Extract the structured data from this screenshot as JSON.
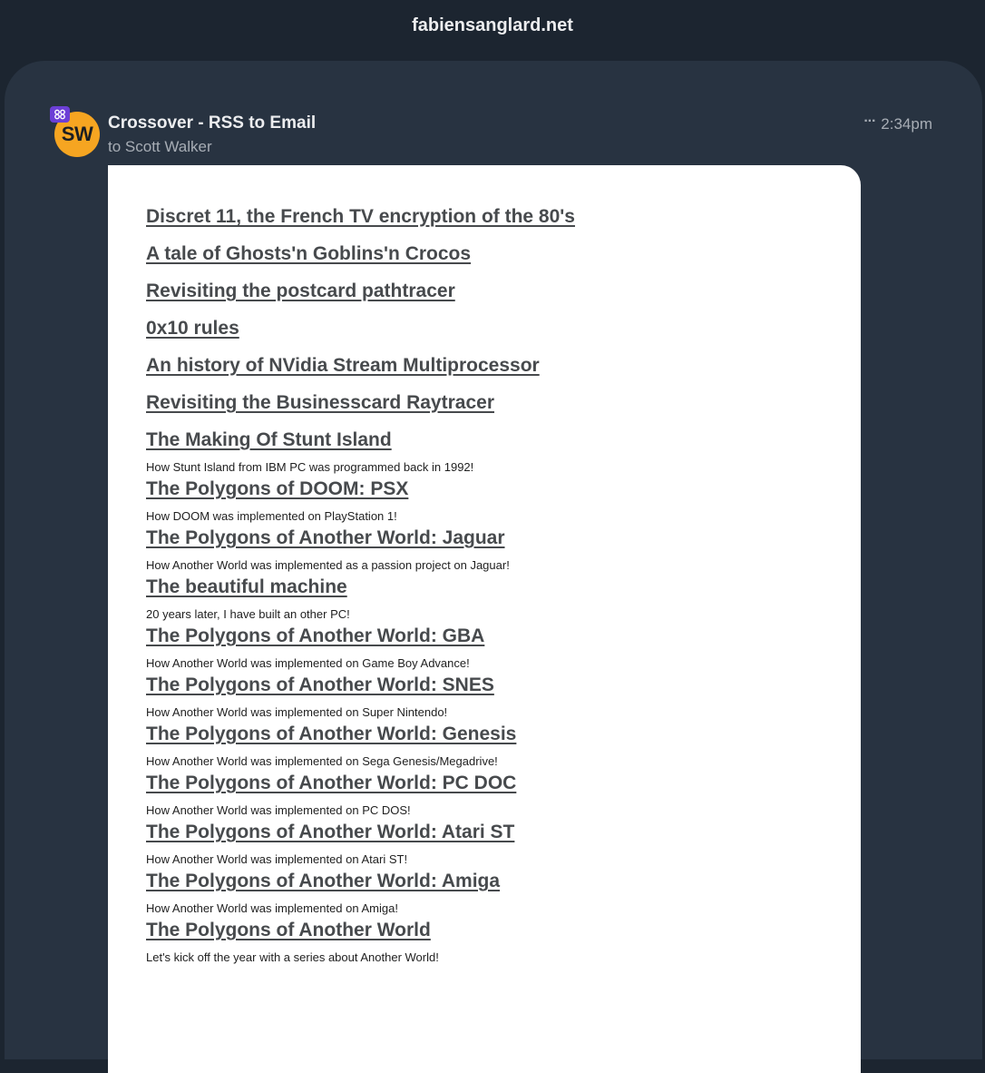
{
  "window": {
    "title": "fabiensanglard.net"
  },
  "message": {
    "avatar_initials": "SW",
    "sender": "Crossover - RSS to Email",
    "recipient": "to Scott Walker",
    "more_label": "···",
    "time": "2:34pm"
  },
  "colors": {
    "avatar": "#f6a521",
    "badge": "#6c3fd6",
    "background": "#1c2530",
    "card": "#283341"
  },
  "entries": [
    {
      "title": "Discret 11, the French TV encryption of the 80's",
      "desc": ""
    },
    {
      "title": "A tale of Ghosts'n Goblins'n Crocos",
      "desc": ""
    },
    {
      "title": "Revisiting the postcard pathtracer",
      "desc": ""
    },
    {
      "title": "0x10 rules",
      "desc": ""
    },
    {
      "title": "An history of NVidia Stream Multiprocessor",
      "desc": ""
    },
    {
      "title": "Revisiting the Businesscard Raytracer",
      "desc": ""
    },
    {
      "title": "The Making Of Stunt Island",
      "desc": "How Stunt Island from IBM PC was programmed back in 1992!"
    },
    {
      "title": "The Polygons of DOOM: PSX",
      "desc": "How DOOM was implemented on PlayStation 1!"
    },
    {
      "title": "The Polygons of Another World: Jaguar",
      "desc": "How Another World was implemented as a passion project on Jaguar!"
    },
    {
      "title": "The beautiful machine",
      "desc": "20 years later, I have built an other PC!"
    },
    {
      "title": "The Polygons of Another World: GBA",
      "desc": "How Another World was implemented on Game Boy Advance!"
    },
    {
      "title": "The Polygons of Another World: SNES",
      "desc": "How Another World was implemented on Super Nintendo!"
    },
    {
      "title": "The Polygons of Another World: Genesis",
      "desc": "How Another World was implemented on Sega Genesis/Megadrive!"
    },
    {
      "title": "The Polygons of Another World: PC DOC",
      "desc": "How Another World was implemented on PC DOS!"
    },
    {
      "title": "The Polygons of Another World: Atari ST",
      "desc": "How Another World was implemented on Atari ST!"
    },
    {
      "title": "The Polygons of Another World: Amiga",
      "desc": "How Another World was implemented on Amiga!"
    },
    {
      "title": "The Polygons of Another World",
      "desc": "Let's kick off the year with a series about Another World!"
    }
  ]
}
